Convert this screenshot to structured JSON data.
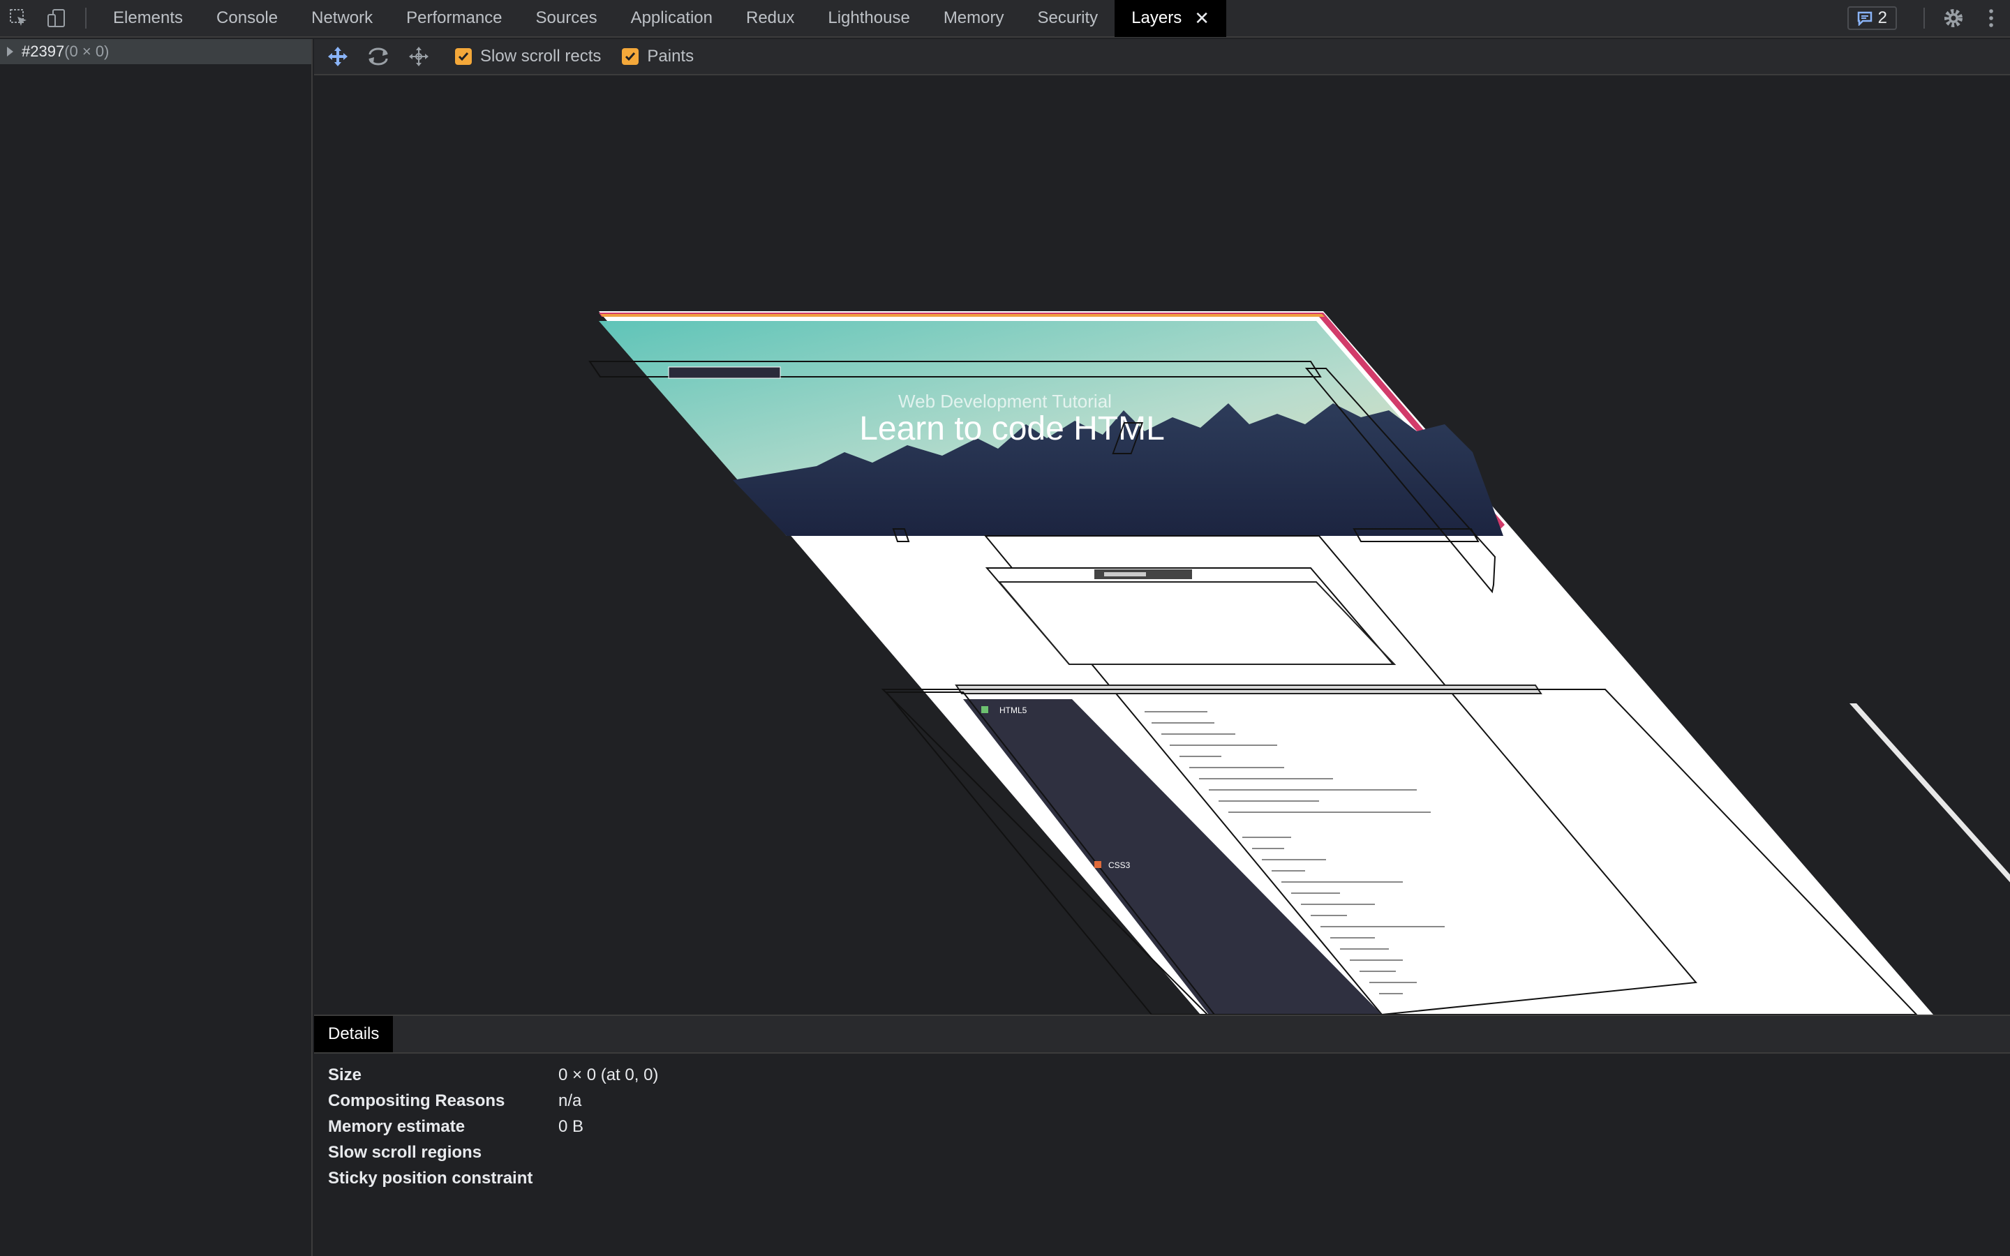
{
  "topbar": {
    "tabs": [
      {
        "label": "Elements"
      },
      {
        "label": "Console"
      },
      {
        "label": "Network"
      },
      {
        "label": "Performance"
      },
      {
        "label": "Sources"
      },
      {
        "label": "Application"
      },
      {
        "label": "Redux"
      },
      {
        "label": "Lighthouse"
      },
      {
        "label": "Memory"
      },
      {
        "label": "Security"
      },
      {
        "label": "Layers"
      }
    ],
    "active_tab": "Layers",
    "issues_count": "2"
  },
  "layer_tree": {
    "root_id": "#2397",
    "root_size": "(0 × 0)"
  },
  "toolbar": {
    "slow_scroll_label": "Slow scroll rects",
    "slow_scroll_checked": true,
    "paints_label": "Paints",
    "paints_checked": true
  },
  "preview": {
    "subtitle": "Web Development Tutorial",
    "headline": "Learn to code HTML",
    "sidebar_heading_1": "HTML5",
    "sidebar_heading_2": "CSS3"
  },
  "details": {
    "tab_label": "Details",
    "rows": [
      {
        "label": "Size",
        "value": "0 × 0 (at 0, 0)"
      },
      {
        "label": "Compositing Reasons",
        "value": "n/a"
      },
      {
        "label": "Memory estimate",
        "value": "0 B"
      },
      {
        "label": "Slow scroll regions",
        "value": ""
      },
      {
        "label": "Sticky position constraint",
        "value": ""
      }
    ]
  },
  "colors": {
    "accent": "#f4a83a",
    "panel_bg": "#202124",
    "toolbar_bg": "#292a2d",
    "link_blue": "#8ab4f8"
  }
}
